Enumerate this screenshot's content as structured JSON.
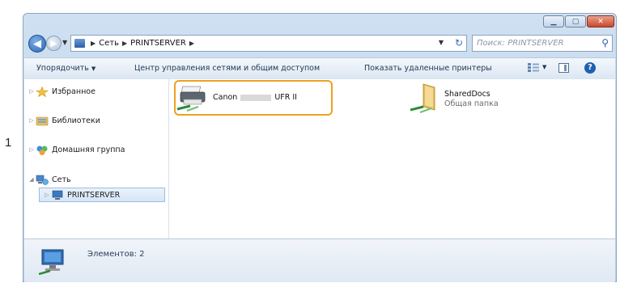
{
  "step_label": "1",
  "address": {
    "crumbs": [
      "Сеть",
      "PRINTSERVER"
    ],
    "search_placeholder": "Поиск: PRINTSERVER"
  },
  "toolbar": {
    "organize": "Упорядочить",
    "network_center": "Центр управления сетями и общим доступом",
    "show_remote_printers": "Показать удаленные принтеры"
  },
  "navpane": {
    "favorites": "Избранное",
    "libraries": "Библиотеки",
    "homegroup": "Домашняя группа",
    "network": "Сеть",
    "printserver": "PRINTSERVER"
  },
  "items": [
    {
      "name_prefix": "Canon",
      "name_suffix": "UFR II",
      "icon": "printer-icon"
    },
    {
      "name": "SharedDocs",
      "subtitle": "Общая папка",
      "icon": "shared-folder-icon"
    }
  ],
  "status": {
    "count_text": "Элементов: 2"
  },
  "colors": {
    "highlight": "#f0a020",
    "accent": "#2d5fa8"
  }
}
